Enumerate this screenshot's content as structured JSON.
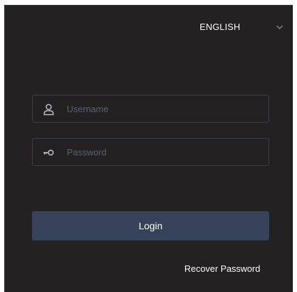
{
  "language": {
    "selected": "ENGLISH",
    "icon": "chevron-down-icon"
  },
  "username": {
    "placeholder": "Username",
    "value": "",
    "icon": "user-icon"
  },
  "password": {
    "placeholder": "Password",
    "value": "",
    "icon": "key-icon"
  },
  "login": {
    "label": "Login"
  },
  "recover": {
    "label": "Recover Password"
  },
  "colors": {
    "panel_bg": "#232121",
    "field_border": "#3b3f48",
    "button_bg": "#36415a",
    "placeholder": "#5d6270",
    "text": "#ffffff"
  }
}
